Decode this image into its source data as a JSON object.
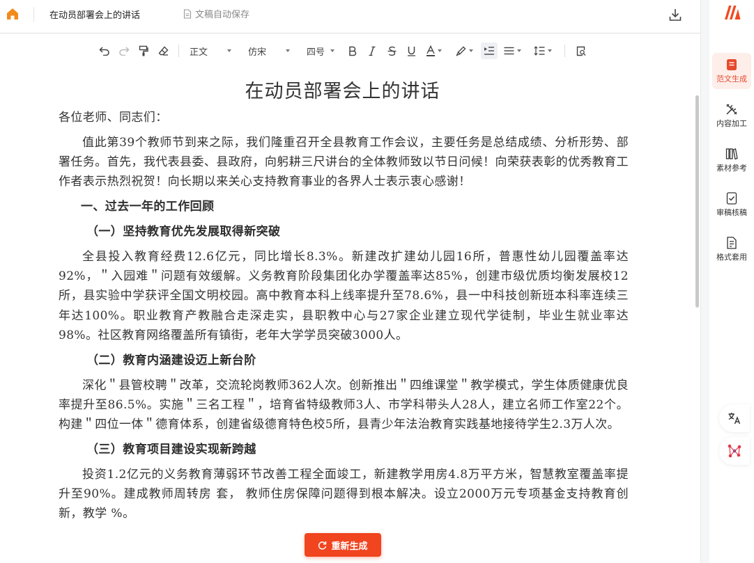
{
  "header": {
    "title": "在动员部署会上的讲话",
    "autosave_label": "文稿自动保存"
  },
  "toolbar": {
    "paragraph_style": "正文",
    "font_family": "仿宋",
    "font_size": "四号"
  },
  "document": {
    "heading": "在动员部署会上的讲话",
    "paragraphs": [
      {
        "type": "plain",
        "text": "各位老师、同志们："
      },
      {
        "type": "indent",
        "text": "值此第39个教师节到来之际，我们隆重召开全县教育工作会议，主要任务是总结成绩、分析形势、部署任务。首先，我代表县委、县政府，向躬耕三尺讲台的全体教师致以节日问候！向荣获表彰的优秀教育工作者表示热烈祝贺！向长期以来关心支持教育事业的各界人士表示衷心感谢！"
      },
      {
        "type": "h1",
        "text": "一、过去一年的工作回顾"
      },
      {
        "type": "h2",
        "text": "（一）坚持教育优先发展取得新突破"
      },
      {
        "type": "indent",
        "text": "全县投入教育经费12.6亿元，同比增长8.3%。新建改扩建幼儿园16所，普惠性幼儿园覆盖率达92%，＂入园难＂问题有效缓解。义务教育阶段集团化办学覆盖率达85%，创建市级优质均衡发展校12所，县实验中学获评全国文明校园。高中教育本科上线率提升至78.6%，县一中科技创新班本科率连续三年达100%。职业教育产教融合走深走实，县职教中心与27家企业建立现代学徒制，毕业生就业率达98%。社区教育网络覆盖所有镇街，老年大学学员突破3000人。"
      },
      {
        "type": "h2",
        "text": "（二）教育内涵建设迈上新台阶"
      },
      {
        "type": "indent",
        "text": "深化＂县管校聘＂改革，交流轮岗教师362人次。创新推出＂四维课堂＂教学模式，学生体质健康优良率提升至86.5%。实施＂三名工程＂，培育省特级教师3人、市学科带头人28人，建立名师工作室22个。构建＂四位一体＂德育体系，创建省级德育特色校5所，县青少年法治教育实践基地接待学生2.3万人次。"
      },
      {
        "type": "h2",
        "text": "（三）教育项目建设实现新跨越"
      },
      {
        "type": "indent",
        "text": "投资1.2亿元的义务教育薄弱环节改善工程全面竣工，新建教学用房4.8万平方米，智慧教室覆盖率提升至90%。建成教师周转房    套，   教师住房保障问题得到根本解决。设立2000万元专项基金支持教育创新，教学      %。"
      }
    ]
  },
  "regenerate_label": "重新生成",
  "sidebar": {
    "items": [
      {
        "label": "范文生成",
        "icon": "document-icon",
        "active": true
      },
      {
        "label": "内容加工",
        "icon": "tools-icon",
        "active": false
      },
      {
        "label": "素材参考",
        "icon": "books-icon",
        "active": false
      },
      {
        "label": "审稿核稿",
        "icon": "check-doc-icon",
        "active": false
      },
      {
        "label": "格式套用",
        "icon": "format-icon",
        "active": false
      }
    ]
  },
  "colors": {
    "accent": "#f0451f",
    "sidebar_active_bg": "#fdeeea"
  }
}
